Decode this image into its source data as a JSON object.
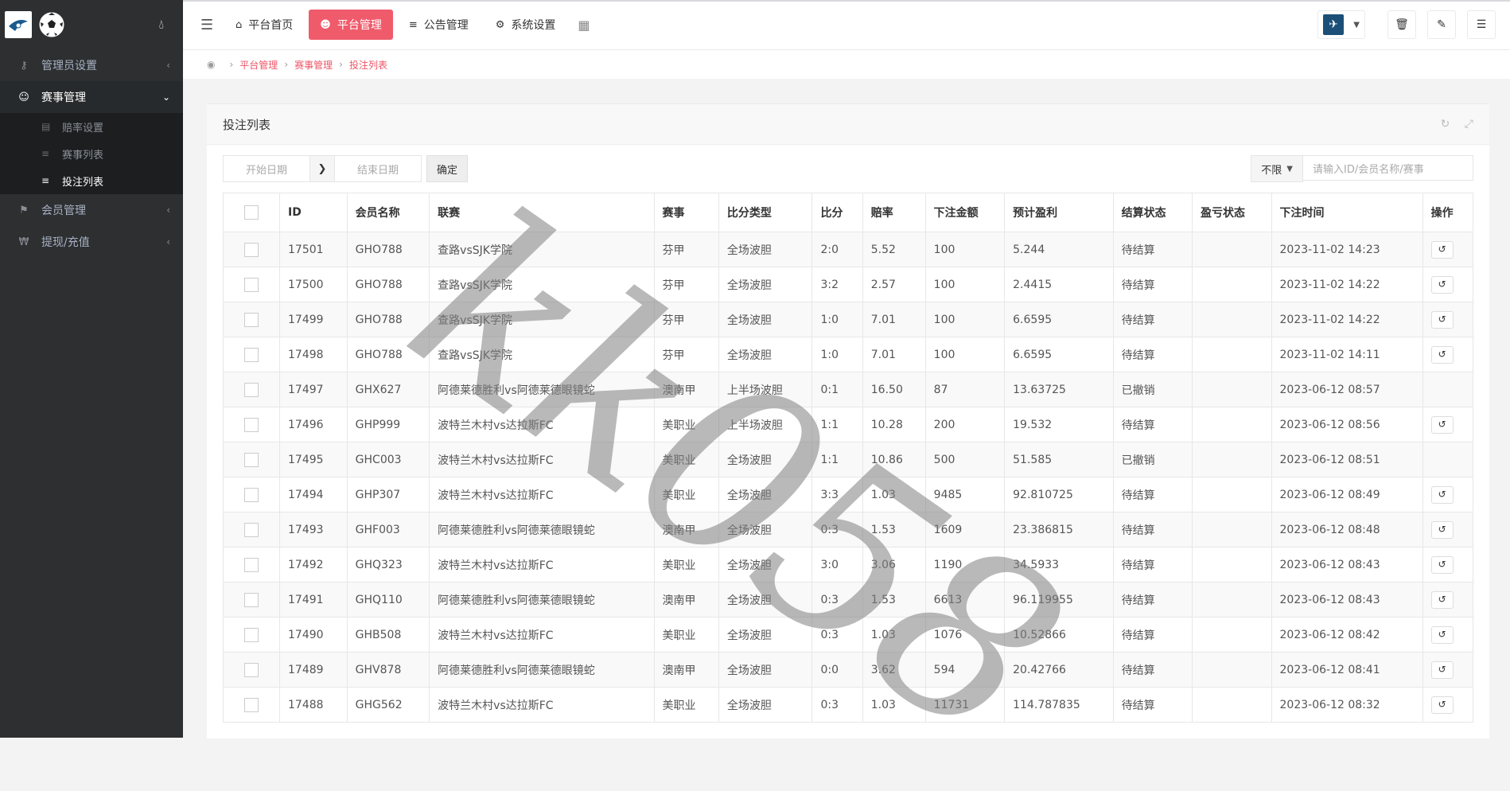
{
  "sidebar": {
    "menu": [
      {
        "label": "管理员设置",
        "icon": "key-icon",
        "expanded": false
      },
      {
        "label": "赛事管理",
        "icon": "users-icon",
        "expanded": true,
        "children": [
          {
            "label": "赔率设置",
            "icon": "table-icon"
          },
          {
            "label": "赛事列表",
            "icon": "list-icon"
          },
          {
            "label": "投注列表",
            "icon": "bars-icon",
            "current": true
          }
        ]
      },
      {
        "label": "会员管理",
        "icon": "tshirt-icon",
        "expanded": false
      },
      {
        "label": "提现/充值",
        "icon": "won-icon",
        "expanded": false
      }
    ]
  },
  "topbar": {
    "tabs": [
      {
        "label": "平台首页",
        "icon": "home-icon"
      },
      {
        "label": "平台管理",
        "icon": "user-icon",
        "active": true
      },
      {
        "label": "公告管理",
        "icon": "list-icon"
      },
      {
        "label": "系统设置",
        "icon": "gear-icon"
      }
    ]
  },
  "breadcrumb": [
    "平台管理",
    "赛事管理",
    "投注列表"
  ],
  "panel": {
    "title": "投注列表",
    "start_date_placeholder": "开始日期",
    "end_date_placeholder": "结束日期",
    "confirm_label": "确定",
    "filter_value": "不限",
    "search_placeholder": "请输入ID/会员名称/赛事"
  },
  "table": {
    "columns": [
      "ID",
      "会员名称",
      "联赛",
      "赛事",
      "比分类型",
      "比分",
      "赔率",
      "下注金额",
      "预计盈利",
      "结算状态",
      "盈亏状态",
      "下注时间",
      "操作"
    ],
    "rows": [
      [
        "17501",
        "GHO788",
        "查路vsSJK学院",
        "芬甲",
        "全场波胆",
        "2:0",
        "5.52",
        "100",
        "5.244",
        "待结算",
        "",
        "2023-11-02 14:23",
        true
      ],
      [
        "17500",
        "GHO788",
        "查路vsSJK学院",
        "芬甲",
        "全场波胆",
        "3:2",
        "2.57",
        "100",
        "2.4415",
        "待结算",
        "",
        "2023-11-02 14:22",
        true
      ],
      [
        "17499",
        "GHO788",
        "查路vsSJK学院",
        "芬甲",
        "全场波胆",
        "1:0",
        "7.01",
        "100",
        "6.6595",
        "待结算",
        "",
        "2023-11-02 14:22",
        true
      ],
      [
        "17498",
        "GHO788",
        "查路vsSJK学院",
        "芬甲",
        "全场波胆",
        "1:0",
        "7.01",
        "100",
        "6.6595",
        "待结算",
        "",
        "2023-11-02 14:11",
        true
      ],
      [
        "17497",
        "GHX627",
        "阿德莱德胜利vs阿德莱德眼镜蛇",
        "澳南甲",
        "上半场波胆",
        "0:1",
        "16.50",
        "87",
        "13.63725",
        "已撤销",
        "",
        "2023-06-12 08:57",
        false
      ],
      [
        "17496",
        "GHP999",
        "波特兰木村vs达拉斯FC",
        "美职业",
        "上半场波胆",
        "1:1",
        "10.28",
        "200",
        "19.532",
        "待结算",
        "",
        "2023-06-12 08:56",
        true
      ],
      [
        "17495",
        "GHC003",
        "波特兰木村vs达拉斯FC",
        "美职业",
        "全场波胆",
        "1:1",
        "10.86",
        "500",
        "51.585",
        "已撤销",
        "",
        "2023-06-12 08:51",
        false
      ],
      [
        "17494",
        "GHP307",
        "波特兰木村vs达拉斯FC",
        "美职业",
        "全场波胆",
        "3:3",
        "1.03",
        "9485",
        "92.810725",
        "待结算",
        "",
        "2023-06-12 08:49",
        true
      ],
      [
        "17493",
        "GHF003",
        "阿德莱德胜利vs阿德莱德眼镜蛇",
        "澳南甲",
        "全场波胆",
        "0:3",
        "1.53",
        "1609",
        "23.386815",
        "待结算",
        "",
        "2023-06-12 08:48",
        true
      ],
      [
        "17492",
        "GHQ323",
        "波特兰木村vs达拉斯FC",
        "美职业",
        "全场波胆",
        "3:0",
        "3.06",
        "1190",
        "34.5933",
        "待结算",
        "",
        "2023-06-12 08:43",
        true
      ],
      [
        "17491",
        "GHQ110",
        "阿德莱德胜利vs阿德莱德眼镜蛇",
        "澳南甲",
        "全场波胆",
        "0:3",
        "1.53",
        "6613",
        "96.119955",
        "待结算",
        "",
        "2023-06-12 08:43",
        true
      ],
      [
        "17490",
        "GHB508",
        "波特兰木村vs达拉斯FC",
        "美职业",
        "全场波胆",
        "0:3",
        "1.03",
        "1076",
        "10.52866",
        "待结算",
        "",
        "2023-06-12 08:42",
        true
      ],
      [
        "17489",
        "GHV878",
        "阿德莱德胜利vs阿德莱德眼镜蛇",
        "澳南甲",
        "全场波胆",
        "0:0",
        "3.62",
        "594",
        "20.42766",
        "待结算",
        "",
        "2023-06-12 08:41",
        true
      ],
      [
        "17488",
        "GHG562",
        "波特兰木村vs达拉斯FC",
        "美职业",
        "全场波胆",
        "0:3",
        "1.03",
        "11731",
        "114.787835",
        "待结算",
        "",
        "2023-06-12 08:32",
        true
      ]
    ]
  },
  "watermark": "kk058"
}
